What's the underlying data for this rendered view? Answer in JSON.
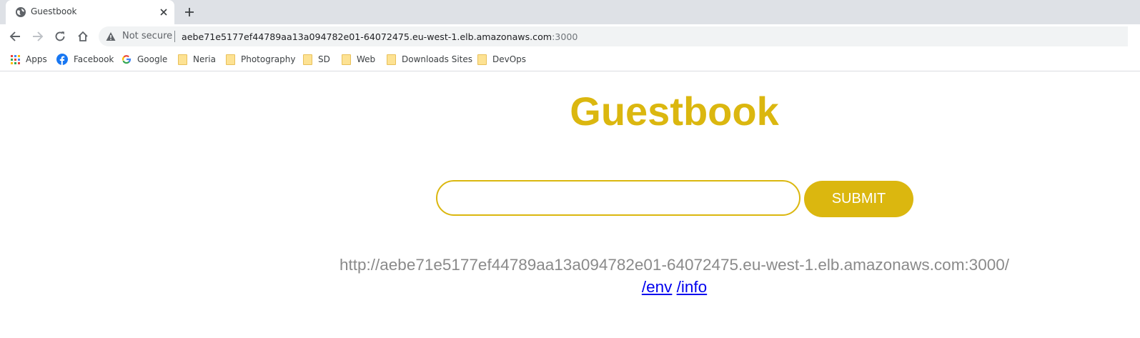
{
  "browser": {
    "tab": {
      "title": "Guestbook",
      "favicon": "globe-icon"
    },
    "toolbar": {
      "security_label": "Not secure",
      "url_host": "aebe71e5177ef44789aa13a094782e01-64072475.eu-west-1.elb.amazonaws.com",
      "url_port": ":3000"
    },
    "bookmarks": [
      {
        "label": "Apps",
        "icon": "apps-grid-icon"
      },
      {
        "label": "Facebook",
        "icon": "facebook-icon"
      },
      {
        "label": "Google",
        "icon": "google-icon"
      },
      {
        "label": "Neria",
        "icon": "folder-icon"
      },
      {
        "label": "Photography",
        "icon": "folder-icon"
      },
      {
        "label": "SD",
        "icon": "folder-icon"
      },
      {
        "label": "Web",
        "icon": "folder-icon"
      },
      {
        "label": "Downloads Sites",
        "icon": "folder-icon"
      },
      {
        "label": "DevOps",
        "icon": "folder-icon"
      }
    ]
  },
  "page": {
    "title": "Guestbook",
    "input": {
      "value": "",
      "placeholder": ""
    },
    "submit_label": "SUBMIT",
    "host": "http://aebe71e5177ef44789aa13a094782e01-64072475.eu-west-1.elb.amazonaws.com:3000/",
    "links": [
      {
        "label": "/env"
      },
      {
        "label": "/info"
      }
    ]
  },
  "colors": {
    "accent": "#dbb70f",
    "link": "#0000ee",
    "host_text": "#8a8a8a",
    "tabstrip_bg": "#dee1e6"
  }
}
